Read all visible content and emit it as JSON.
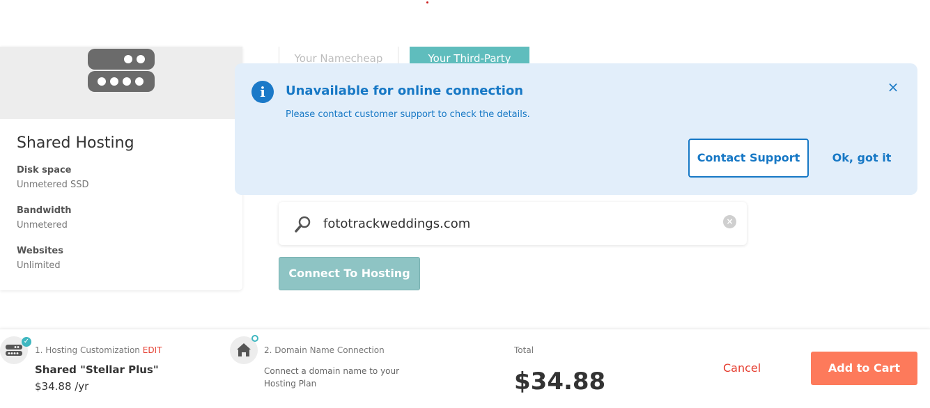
{
  "hosting_card": {
    "title": "Shared Hosting",
    "specs": [
      {
        "label": "Disk space",
        "value": "Unmetered SSD"
      },
      {
        "label": "Bandwidth",
        "value": "Unmetered"
      },
      {
        "label": "Websites",
        "value": "Unlimited"
      }
    ]
  },
  "tabs": [
    {
      "label": "Your Namecheap",
      "active": false
    },
    {
      "label": "Your Third-Party",
      "active": true
    }
  ],
  "alert": {
    "title": "Unavailable for online connection",
    "message": "Please contact customer support to check the details.",
    "close_icon": "×",
    "primary_button": "Contact Support",
    "secondary_button": "Ok, got it"
  },
  "search": {
    "value": "fototrackweddings.com",
    "clear_icon": "×"
  },
  "connect_button": "Connect To Hosting",
  "bottom_bar": {
    "step1": {
      "label": "1. Hosting Customization",
      "edit": "EDIT",
      "title": "Shared \"Stellar Plus\"",
      "price": "$34.88 /yr",
      "badge": "✓"
    },
    "step2": {
      "label": "2. Domain Name Connection",
      "description": "Connect a domain name to your Hosting Plan"
    },
    "total_label": "Total",
    "total_value": "$34.88",
    "cancel": "Cancel",
    "add_to_cart": "Add to Cart"
  },
  "colors": {
    "accent_blue": "#1778c5",
    "alert_bg": "#e2eefa",
    "teal": "#5fbdbd",
    "cta_orange": "#fd7a5b",
    "cancel_red": "#e53e30"
  }
}
